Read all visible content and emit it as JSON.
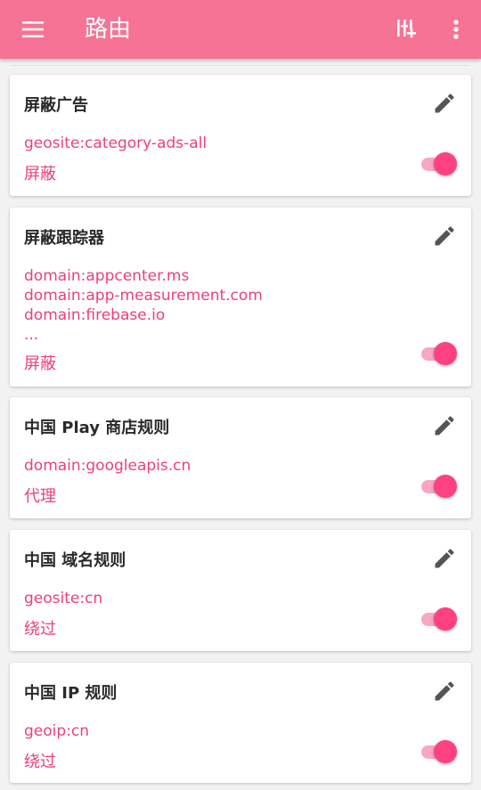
{
  "appbar": {
    "title": "路由",
    "icons": {
      "menu": "menu-icon",
      "add": "add-rule-icon",
      "more": "more-vert-icon"
    }
  },
  "colors": {
    "primary": "#f77395",
    "accent": "#ec407a",
    "switch_thumb": "#ff4081"
  },
  "rules": [
    {
      "title": "屏蔽广告",
      "entries": [
        "geosite:category-ads-all"
      ],
      "outbound": "屏蔽",
      "enabled": true
    },
    {
      "title": "屏蔽跟踪器",
      "entries": [
        "domain:appcenter.ms",
        "domain:app-measurement.com",
        "domain:firebase.io",
        "..."
      ],
      "outbound": "屏蔽",
      "enabled": true
    },
    {
      "title": "中国 Play 商店规则",
      "entries": [
        "domain:googleapis.cn"
      ],
      "outbound": "代理",
      "enabled": true
    },
    {
      "title": "中国 域名规则",
      "entries": [
        "geosite:cn"
      ],
      "outbound": "绕过",
      "enabled": true
    },
    {
      "title": "中国 IP 规则",
      "entries": [
        "geoip:cn"
      ],
      "outbound": "绕过",
      "enabled": true
    }
  ]
}
